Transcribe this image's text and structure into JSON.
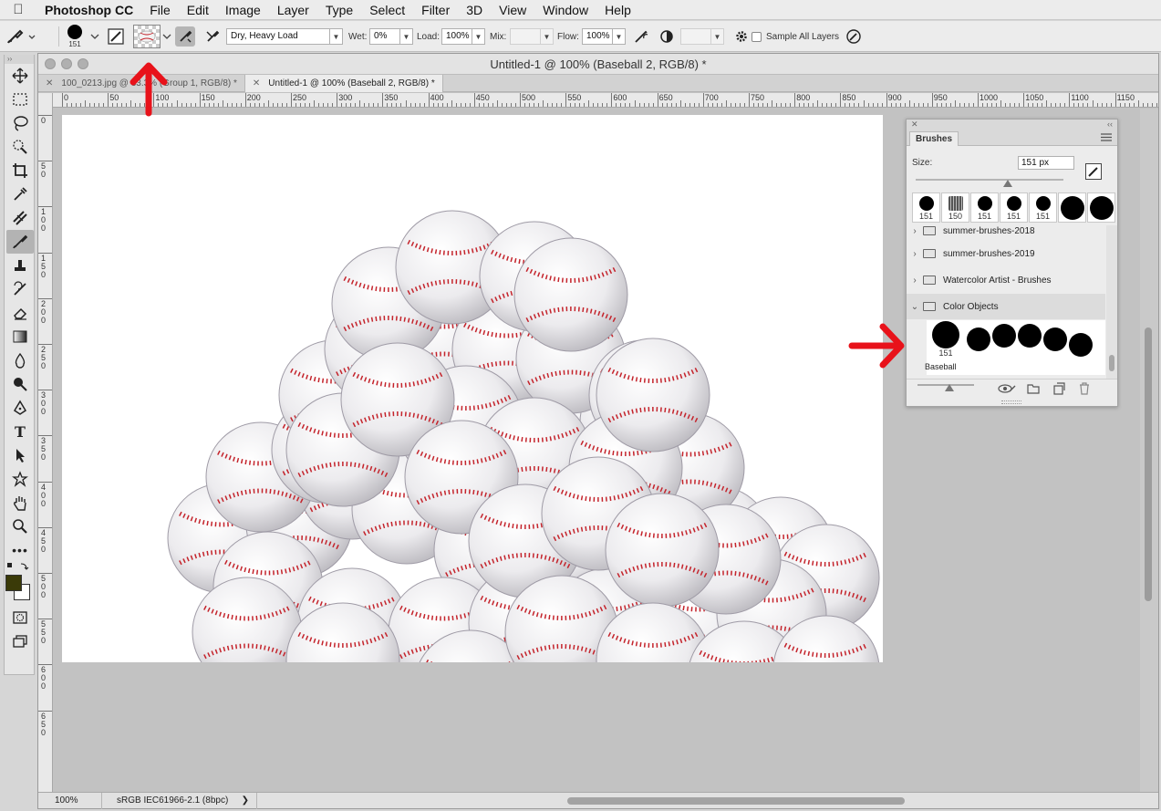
{
  "menubar": {
    "app": "Photoshop CC",
    "items": [
      "File",
      "Edit",
      "Image",
      "Layer",
      "Type",
      "Select",
      "Filter",
      "3D",
      "View",
      "Window",
      "Help"
    ]
  },
  "options": {
    "brush_size": "151",
    "mode_select": "Dry, Heavy Load",
    "wet_label": "Wet:",
    "wet_value": "0%",
    "load_label": "Load:",
    "load_value": "100%",
    "mix_label": "Mix:",
    "mix_value": "",
    "flow_label": "Flow:",
    "flow_value": "100%",
    "sample_all_layers": "Sample All Layers"
  },
  "document": {
    "window_title": "Untitled-1 @ 100% (Baseball 2, RGB/8) *",
    "tabs": [
      {
        "label": "100_0213.jpg @ 33.3% (Group 1, RGB/8) *",
        "active": false
      },
      {
        "label": "Untitled-1 @ 100% (Baseball 2, RGB/8) *",
        "active": true
      }
    ]
  },
  "ruler": {
    "h_labels": [
      "0",
      "50",
      "100",
      "150",
      "200",
      "250",
      "300",
      "350",
      "400",
      "450",
      "500",
      "550",
      "600",
      "650",
      "700",
      "750",
      "800",
      "850",
      "900",
      "950",
      "1000",
      "1050",
      "1100",
      "1150"
    ],
    "v_labels": [
      "0",
      "50",
      "100",
      "150",
      "200",
      "250",
      "300",
      "350",
      "400",
      "450",
      "500",
      "550",
      "600",
      "650"
    ]
  },
  "status": {
    "zoom": "100%",
    "profile": "sRGB IEC61966-2.1 (8bpc)"
  },
  "brushes_panel": {
    "title": "Brushes",
    "size_label": "Size:",
    "size_value": "151 px",
    "presets": [
      "151",
      "150",
      "151",
      "151",
      "151",
      "",
      ""
    ],
    "folders": [
      {
        "name": "summer-brushes-2018",
        "expanded": false
      },
      {
        "name": "summer-brushes-2019",
        "expanded": false
      },
      {
        "name": "Watercolor Artist - Brushes",
        "expanded": false
      },
      {
        "name": "Color Objects",
        "expanded": true
      }
    ],
    "selected_brush": {
      "size": "151",
      "name": "Baseball"
    }
  },
  "colors": {
    "foreground": "#3a3a08",
    "background": "#ffffff",
    "annotation_arrow": "#e8121a",
    "stitch": "#c4232b"
  }
}
